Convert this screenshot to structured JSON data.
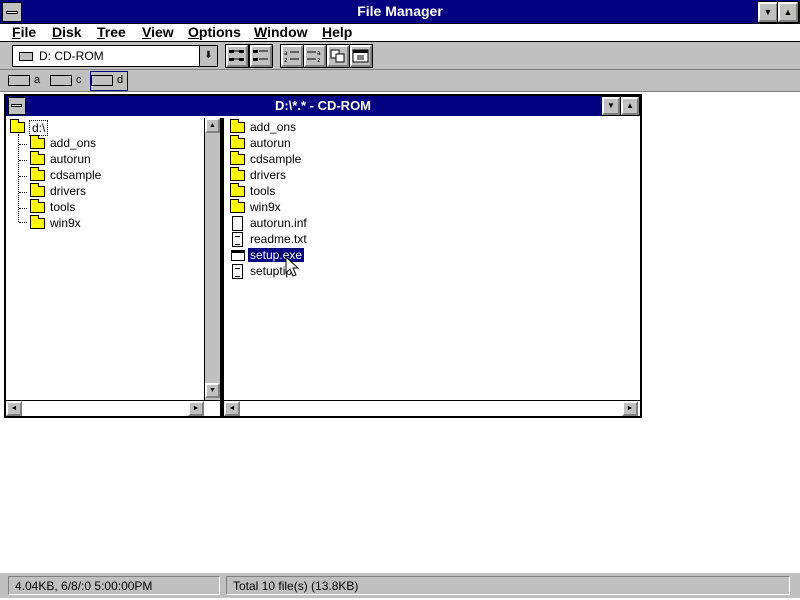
{
  "app": {
    "title": "File Manager",
    "minimize_symbol": "▼",
    "maximize_symbol": "▲"
  },
  "menu": {
    "items": [
      {
        "key": "F",
        "rest": "ile"
      },
      {
        "key": "D",
        "rest": "isk"
      },
      {
        "key": "T",
        "rest": "ree"
      },
      {
        "key": "V",
        "rest": "iew"
      },
      {
        "key": "O",
        "rest": "ptions"
      },
      {
        "key": "W",
        "rest": "indow"
      },
      {
        "key": "H",
        "rest": "elp"
      }
    ]
  },
  "toolbar": {
    "drive_select_value": "D: CD-ROM",
    "drive_select_arrow": "⬇"
  },
  "drives": [
    {
      "letter": "a"
    },
    {
      "letter": "c"
    },
    {
      "letter": "d",
      "selected": true
    }
  ],
  "window": {
    "title": "D:\\*.* - CD-ROM",
    "minimize_symbol": "▼",
    "maximize_symbol": "▲"
  },
  "tree": {
    "root": "d:\\",
    "folders": [
      "add_ons",
      "autorun",
      "cdsample",
      "drivers",
      "tools",
      "win9x"
    ]
  },
  "files": [
    {
      "name": "add_ons",
      "type": "folder"
    },
    {
      "name": "autorun",
      "type": "folder"
    },
    {
      "name": "cdsample",
      "type": "folder"
    },
    {
      "name": "drivers",
      "type": "folder"
    },
    {
      "name": "tools",
      "type": "folder"
    },
    {
      "name": "win9x",
      "type": "folder"
    },
    {
      "name": "autorun.inf",
      "type": "doc"
    },
    {
      "name": "readme.txt",
      "type": "text"
    },
    {
      "name": "setup.exe",
      "type": "exe",
      "selected": true
    },
    {
      "name": "setuptip.",
      "type": "text"
    }
  ],
  "status": {
    "left": "4.04KB, 6/8/:0 5:00:00PM",
    "right": "Total 10 file(s) (13.8KB)"
  },
  "scroll": {
    "up": "▲",
    "down": "▼",
    "left": "◄",
    "right": "►"
  }
}
